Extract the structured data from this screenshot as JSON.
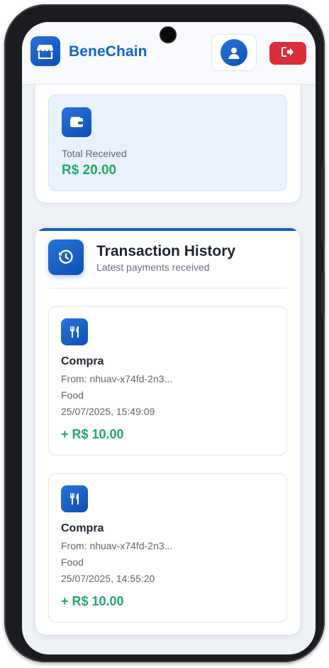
{
  "header": {
    "brand": "BeneChain",
    "icons": {
      "logo": "store-icon",
      "avatar": "user-icon",
      "logout": "logout-icon"
    }
  },
  "summary": {
    "icon": "wallet-icon",
    "label": "Total Received",
    "amount": "R$ 20.00"
  },
  "history": {
    "icon": "history-icon",
    "title": "Transaction History",
    "subtitle": "Latest payments received",
    "transactions": [
      {
        "icon": "utensils-icon",
        "title": "Compra",
        "from": "From: nhuav-x74fd-2n3...",
        "category": "Food",
        "date": "25/07/2025, 15:49:09",
        "amount": "+ R$ 10.00"
      },
      {
        "icon": "utensils-icon",
        "title": "Compra",
        "from": "From: nhuav-x74fd-2n3...",
        "category": "Food",
        "date": "25/07/2025, 14:55:20",
        "amount": "+ R$ 10.00"
      }
    ]
  },
  "colors": {
    "brand_blue": "#1565c8",
    "accent_green": "#22a866",
    "logout_red": "#dc2d3b"
  }
}
